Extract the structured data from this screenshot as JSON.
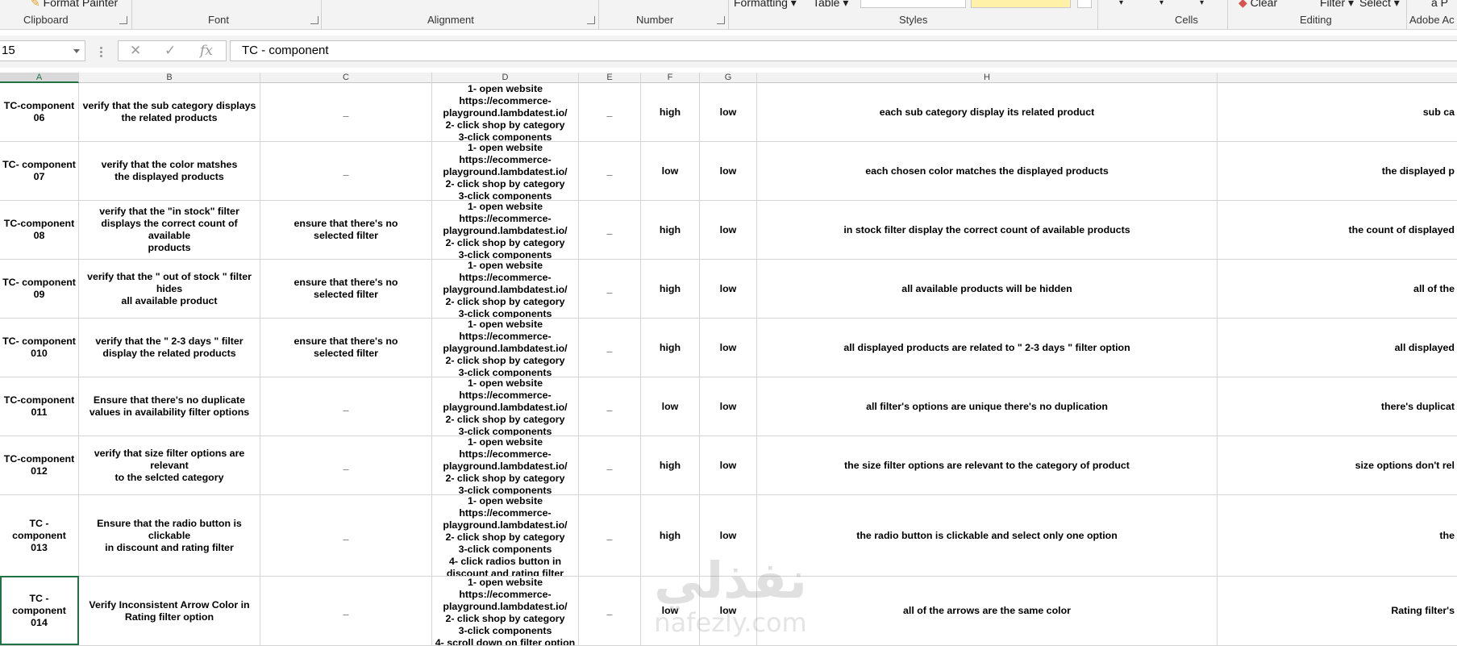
{
  "ribbon": {
    "clipboard_label": "Clipboard",
    "font_label": "Font",
    "alignment_label": "Alignment",
    "number_label": "Number",
    "styles_label": "Styles",
    "cells_label": "Cells",
    "editing_label": "Editing",
    "adobe_label": "Adobe Ac",
    "format_painter_label": "Format Painter",
    "conditional_formatting_label": "Formatting",
    "format_as_table_label": "Table",
    "clear_label": "Clear",
    "filter_label": "Filter",
    "select_label": "Select",
    "adobe_top_label": "a P"
  },
  "formula_bar": {
    "name_box": "15",
    "cancel_icon": "✕",
    "enter_icon": "✓",
    "fx_label": "fx",
    "formula": "TC - component"
  },
  "columns": [
    "A",
    "B",
    "C",
    "D",
    "E",
    "F",
    "G",
    "H"
  ],
  "rows": [
    {
      "id": "TC-component\n06",
      "description": "verify that the sub category displays\nthe related products",
      "precondition": "_",
      "steps": "1- open website\nhttps://ecommerce-\nplayground.lambdatest.io/\n2- click shop by category\n3-click components",
      "data": "_",
      "priority": "high",
      "severity": "low",
      "expected": "each sub category display its related product",
      "actual": "sub ca"
    },
    {
      "id": "TC- component\n07",
      "description": "verify that the color matshes\nthe displayed products",
      "precondition": "_",
      "steps": "1- open website\nhttps://ecommerce-\nplayground.lambdatest.io/\n2- click shop by category\n3-click components",
      "data": "_",
      "priority": "low",
      "severity": "low",
      "expected": "each chosen color matches the displayed products",
      "actual": "the displayed p"
    },
    {
      "id": "TC-component\n08",
      "description": "verify that the \"in stock\" filter\ndisplays the correct count of available\nproducts",
      "precondition": "ensure that there's no\nselected filter",
      "steps": "1- open website\nhttps://ecommerce-\nplayground.lambdatest.io/\n2- click shop by category\n3-click components",
      "data": "_",
      "priority": "high",
      "severity": "low",
      "expected": "in stock filter display the correct count of available products",
      "actual": "the count of displayed"
    },
    {
      "id": "TC- component\n09",
      "description": "verify that  the \" out of stock \" filter\nhides\nall available product",
      "precondition": "ensure that there's no\nselected filter",
      "steps": "1- open website\nhttps://ecommerce-\nplayground.lambdatest.io/\n2- click shop by category\n3-click components",
      "data": "_",
      "priority": "high",
      "severity": "low",
      "expected": "all available products will be hidden",
      "actual": "all of the"
    },
    {
      "id": "TC- component\n010",
      "description": "verify that the \" 2-3 days \" filter\ndisplay the related products",
      "precondition": "ensure that there's no\nselected filter",
      "steps": "1- open website\nhttps://ecommerce-\nplayground.lambdatest.io/\n2- click shop by category\n3-click components",
      "data": "_",
      "priority": "high",
      "severity": "low",
      "expected": "all displayed products are related to \" 2-3 days \" filter option",
      "actual": "all displayed"
    },
    {
      "id": "TC-component\n011",
      "description": "Ensure that there's no duplicate\nvalues in availability filter options",
      "precondition": "_",
      "steps": "1- open website\nhttps://ecommerce-\nplayground.lambdatest.io/\n2- click shop by category\n3-click components",
      "data": "_",
      "priority": "low",
      "severity": "low",
      "expected": "all filter's options are unique there's no duplication",
      "actual": "there's duplicat"
    },
    {
      "id": "TC-component\n012",
      "description": "verify that size filter options are\nrelevant\nto the selcted category",
      "precondition": "_",
      "steps": "1- open website\nhttps://ecommerce-\nplayground.lambdatest.io/\n2- click shop by category\n3-click components",
      "data": "_",
      "priority": "high",
      "severity": "low",
      "expected": "the size filter options are relevant to the category of product",
      "actual": "size options don't rel"
    },
    {
      "id": "TC - component\n013",
      "description": "Ensure that the radio button is\nclickable\nin discount and rating filter",
      "precondition": "_",
      "steps": "1- open website\nhttps://ecommerce-\nplayground.lambdatest.io/\n2- click shop by category\n3-click components\n4- click radios button in\ndiscount and rating filter",
      "data": "_",
      "priority": "high",
      "severity": "low",
      "expected": "the radio button is clickable and select only one option",
      "actual": "the"
    },
    {
      "id": "TC - component\n014",
      "description": "Verify Inconsistent Arrow Color in\nRating filter option",
      "precondition": "_",
      "steps": "1- open website\nhttps://ecommerce-\nplayground.lambdatest.io/\n2- click shop by category\n3-click components\n4- scroll down on filter option",
      "data": "_",
      "priority": "low",
      "severity": "low",
      "expected": "all of the arrows are the same color",
      "actual": "Rating filter's"
    }
  ],
  "watermark": {
    "arabic": "نفذلي",
    "latin": "nafezly.com"
  },
  "colors": {
    "excel_green": "#217346",
    "gridline": "#d4d4d4",
    "ribbon_bg": "#f3f3f3"
  }
}
